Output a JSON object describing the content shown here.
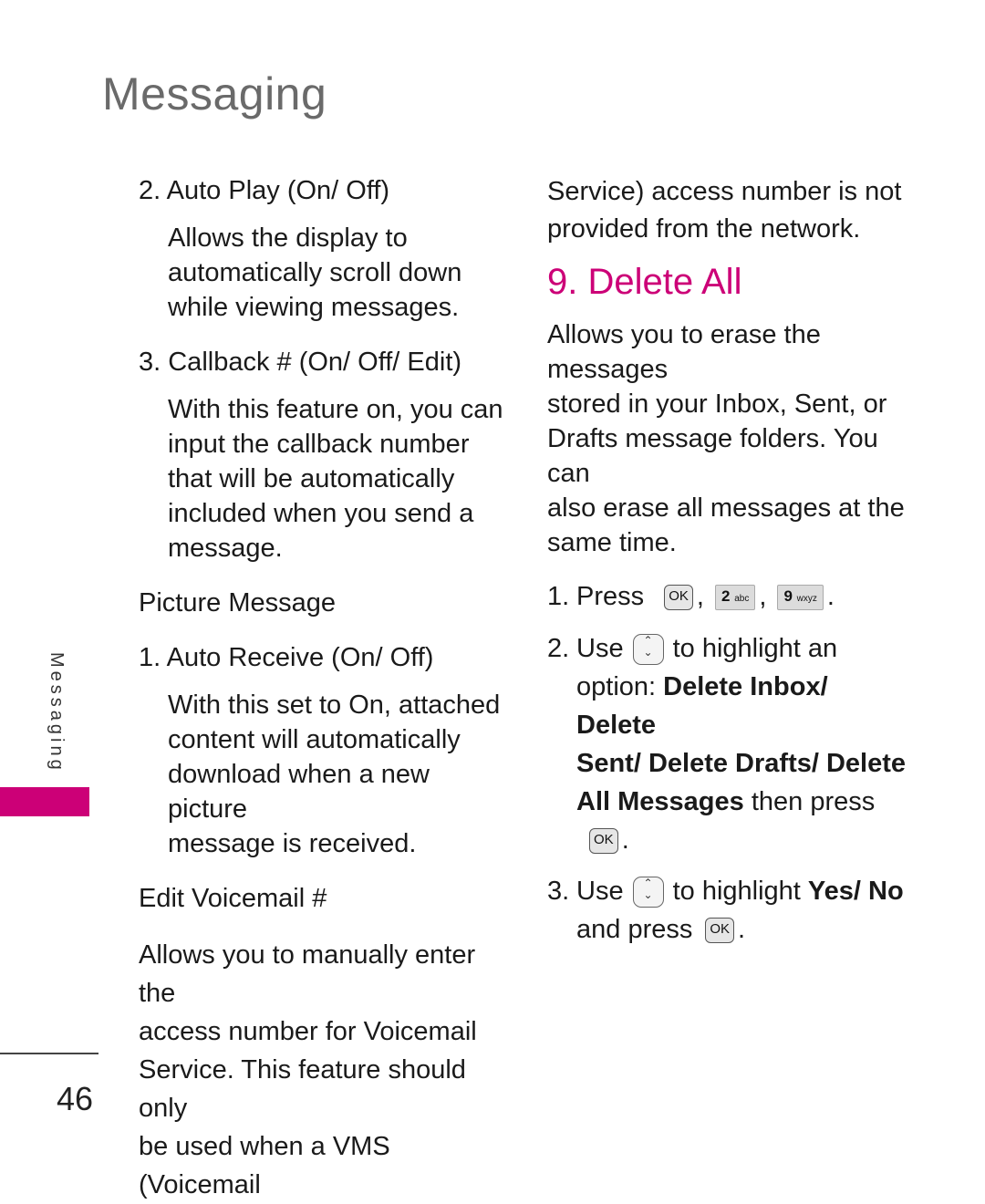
{
  "header": {
    "title": "Messaging"
  },
  "colors": {
    "accent": "#cc0077",
    "title_gray": "#6a6a6a"
  },
  "left": {
    "auto_play": {
      "heading": "2. Auto Play (On/ Off)",
      "lines": [
        "Allows the display to",
        "automatically scroll down",
        "while viewing messages."
      ]
    },
    "callback": {
      "heading": "3. Callback # (On/ Off/ Edit)",
      "lines": [
        "With this feature on, you can",
        "input the callback number",
        "that will be automatically",
        "included when you send a",
        "message."
      ]
    },
    "picture_message": {
      "heading": "Picture Message"
    },
    "auto_receive": {
      "heading": "1. Auto Receive (On/ Off)",
      "lines": [
        "With this set to On, attached",
        "content will automatically",
        "download when a new picture",
        "message is received."
      ]
    },
    "edit_voicemail": {
      "heading": "Edit Voicemail #",
      "lines": [
        "Allows you to manually enter the",
        "access number for Voicemail",
        "Service. This feature should only",
        "be used when a VMS (Voicemail"
      ]
    }
  },
  "right": {
    "continuation": [
      "Service) access number is not",
      "provided from the network."
    ],
    "delete_all": {
      "title": "9. Delete All",
      "lines": [
        "Allows you to erase the messages",
        "stored in your Inbox, Sent, or",
        "Drafts message folders. You can",
        "also erase all messages at the",
        "same time."
      ],
      "steps": [
        {
          "num": "1.",
          "text_a": "Press",
          "keys": [
            "OK",
            "2",
            "abc",
            "9",
            "wxyz"
          ]
        },
        {
          "num": "2.",
          "text_a": "Use",
          "text_b": "to highlight an",
          "text_c": "option:",
          "bold_a": "Delete Inbox/ Delete",
          "bold_b": "Sent/ Delete Drafts/ Delete",
          "bold_c": "All Messages",
          "text_d": "then press",
          "key": "OK"
        },
        {
          "num": "3.",
          "text_a": "Use",
          "text_b": "to highlight",
          "bold_a": "Yes/ No",
          "text_c": "and press",
          "key": "OK"
        }
      ]
    }
  },
  "sidebar": {
    "section_label": "Messaging"
  },
  "footer": {
    "page_number": "46"
  }
}
